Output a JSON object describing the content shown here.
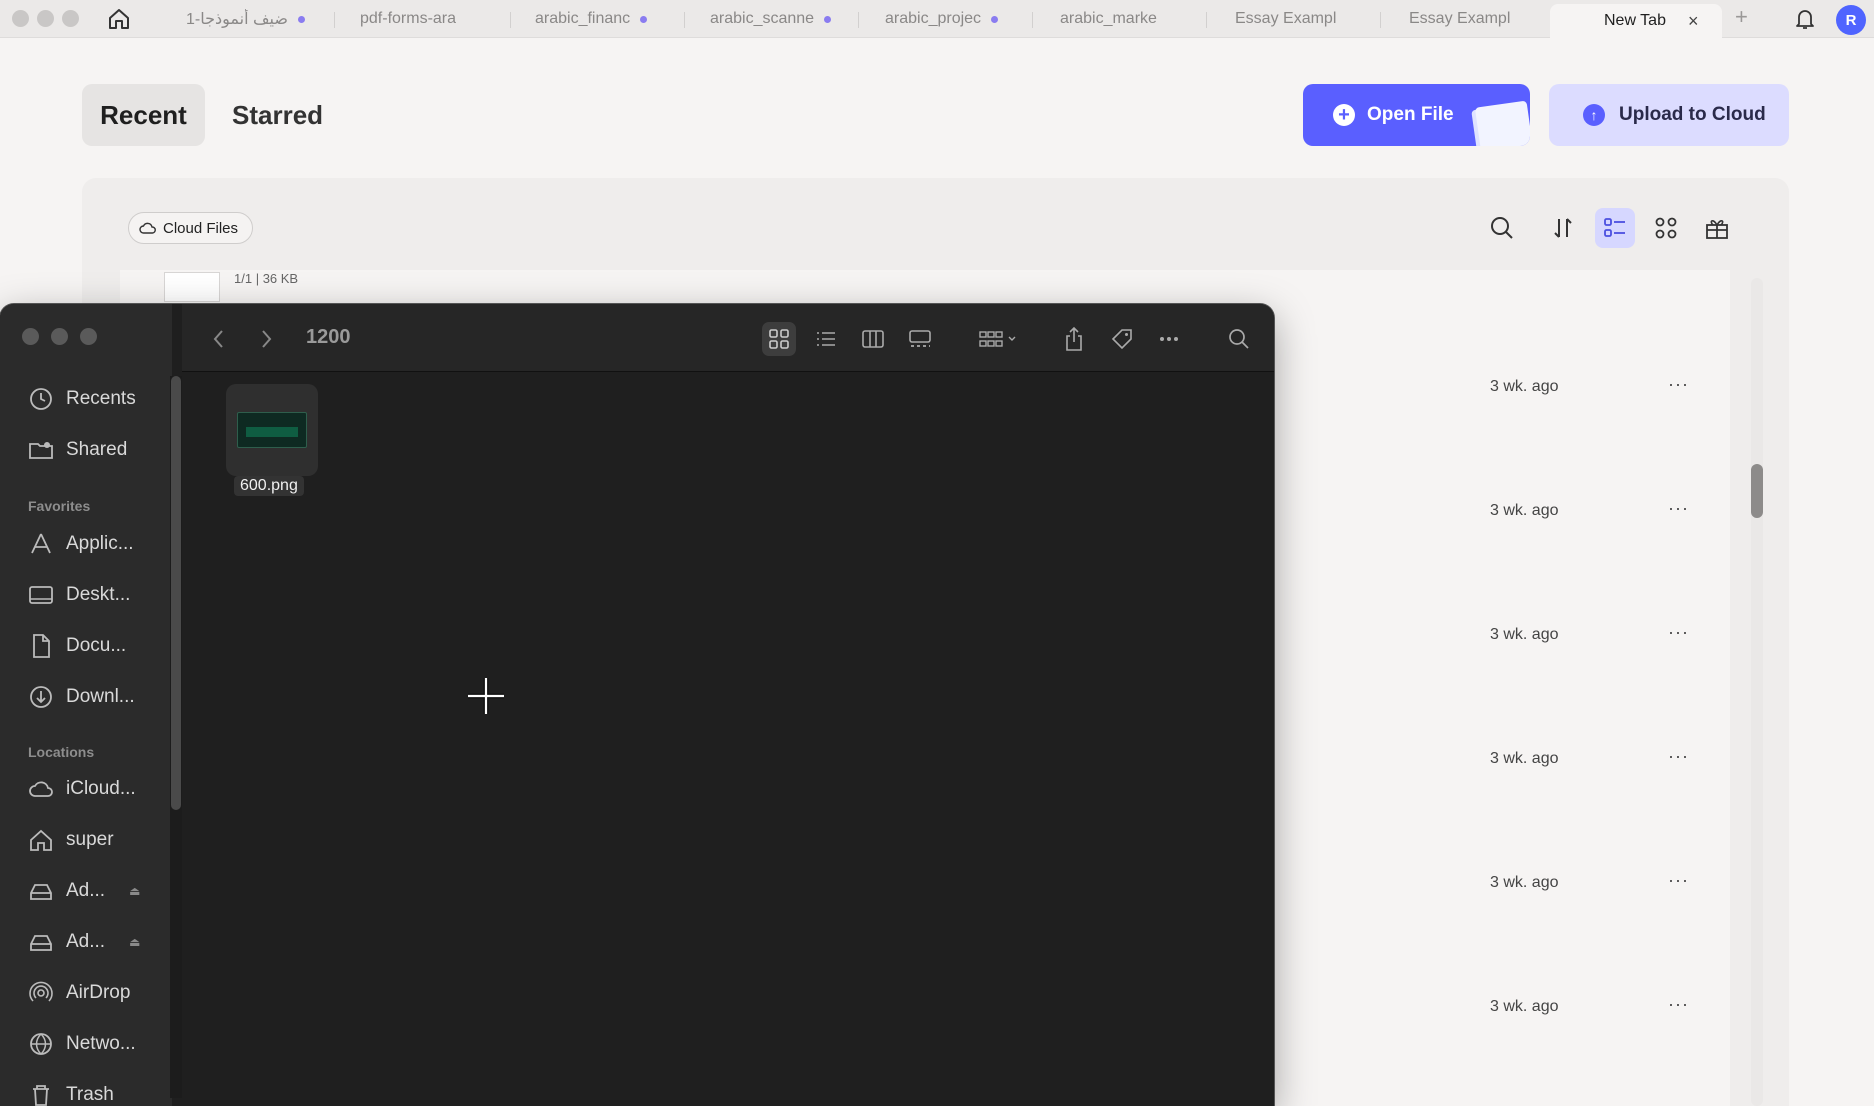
{
  "browser": {
    "tabs": [
      {
        "label": "ضيف أنموذجا-1",
        "dot": true
      },
      {
        "label": "pdf-forms-ara",
        "dot": false
      },
      {
        "label": "arabic_financ",
        "dot": true
      },
      {
        "label": "arabic_scanne",
        "dot": true
      },
      {
        "label": "arabic_projec",
        "dot": true
      },
      {
        "label": "arabic_marke",
        "dot": false
      },
      {
        "label": "Essay Exampl",
        "dot": false
      },
      {
        "label": "Essay Exampl",
        "dot": false
      },
      {
        "label": "New Tab",
        "active": true
      }
    ],
    "close_glyph": "×",
    "newtab_glyph": "+",
    "avatar_letter": "R"
  },
  "header": {
    "recent_label": "Recent",
    "starred_label": "Starred",
    "open_file_label": "Open File",
    "upload_label": "Upload to Cloud"
  },
  "panel": {
    "cloud_chip_label": "Cloud Files",
    "top_file_pages": "1/1",
    "top_file_size": "36 KB",
    "rows": [
      {
        "time": "3 wk. ago"
      },
      {
        "time": "3 wk. ago"
      },
      {
        "time": "3 wk. ago"
      },
      {
        "time": "3 wk. ago"
      },
      {
        "time": "3 wk. ago"
      },
      {
        "time": "3 wk. ago"
      }
    ],
    "more_glyph": "···"
  },
  "finder": {
    "title": "1200",
    "sidebar": {
      "top": [
        {
          "label": "Recents",
          "icon": "clock-icon"
        },
        {
          "label": "Shared",
          "icon": "shared-folder-icon"
        }
      ],
      "favorites_heading": "Favorites",
      "favorites": [
        {
          "label": "Applic...",
          "icon": "applications-icon"
        },
        {
          "label": "Deskt...",
          "icon": "desktop-icon"
        },
        {
          "label": "Docu...",
          "icon": "document-icon"
        },
        {
          "label": "Downl...",
          "icon": "download-icon"
        }
      ],
      "locations_heading": "Locations",
      "locations": [
        {
          "label": "iCloud...",
          "icon": "cloud-icon"
        },
        {
          "label": "super",
          "icon": "home-icon"
        },
        {
          "label": "Ad...",
          "icon": "drive-icon",
          "eject": true
        },
        {
          "label": "Ad...",
          "icon": "drive-icon",
          "eject": true
        },
        {
          "label": "AirDrop",
          "icon": "airdrop-icon"
        },
        {
          "label": "Netwo...",
          "icon": "network-icon"
        },
        {
          "label": "Trash",
          "icon": "trash-icon"
        }
      ]
    },
    "file": {
      "name": "600.png",
      "icon": "image-thumbnail-icon"
    }
  },
  "colors": {
    "accent": "#5a5fff",
    "accent_light": "#dcdcff",
    "finder_bg": "#1f1f1f"
  }
}
